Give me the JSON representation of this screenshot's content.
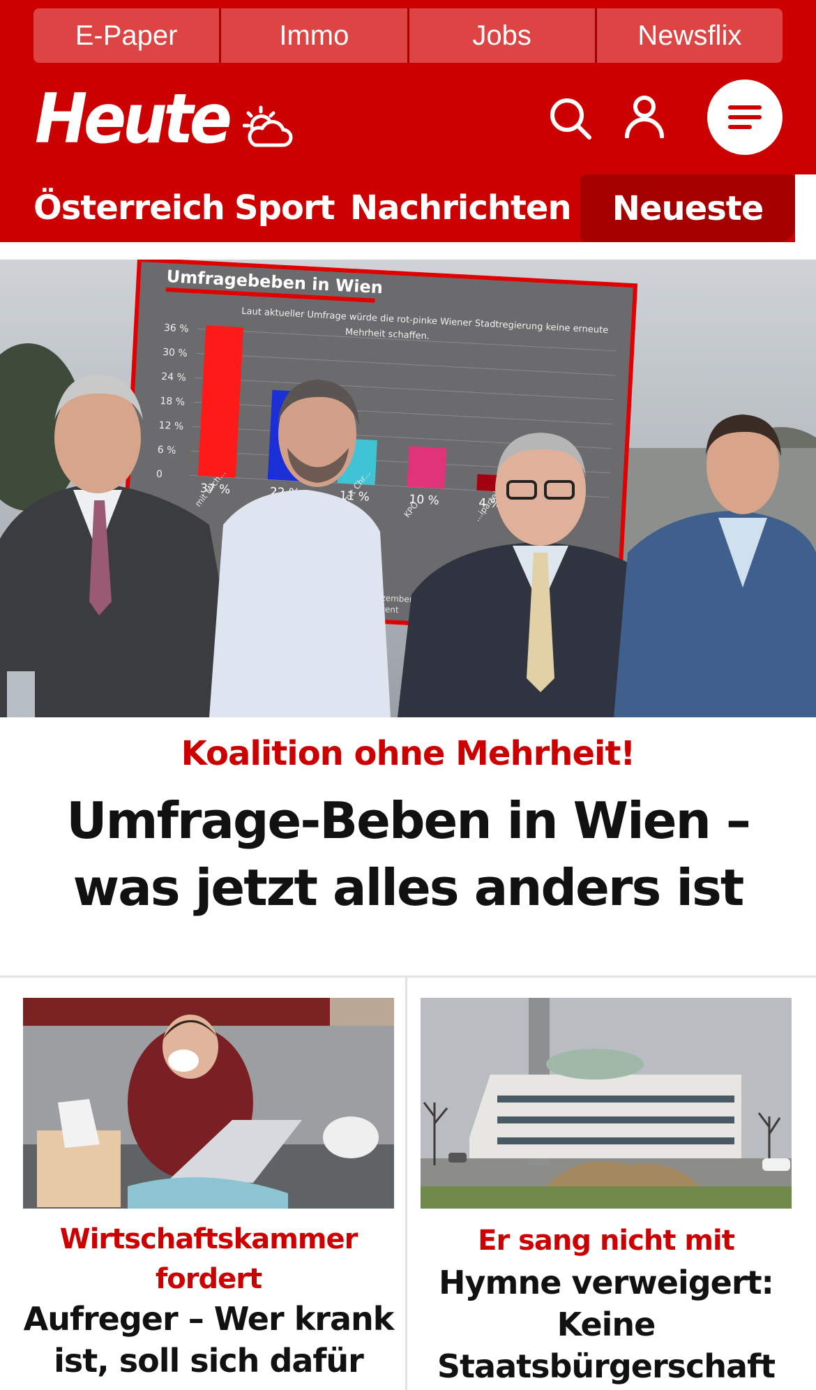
{
  "top_links": [
    "E-Paper",
    "Immo",
    "Jobs",
    "Newsflix"
  ],
  "brand": {
    "logo_text": "Heute",
    "accent": "#cc0000",
    "dark_accent": "#a50000"
  },
  "nav": {
    "items": [
      "Österreich",
      "Sport",
      "Nachrichten"
    ],
    "highlight": "Neueste"
  },
  "hero": {
    "kicker": "Koalition ohne Mehrheit!",
    "title": "Umfrage-Beben in Wien – was jetzt alles anders ist",
    "graphic": {
      "heading": "Umfragebeben in Wien",
      "subtitle_line1": "Laut aktueller Umfrage würde die rot-pinke Wiener Stadtregierung keine erneute",
      "subtitle_line2": "Mehrheit schaffen.",
      "y_ticks": [
        "36 %",
        "30 %",
        "24 %",
        "18 %",
        "12 %",
        "6 %",
        "0"
      ],
      "bar_labels": [
        "37 %",
        "22 %",
        "11 %",
        "10 %",
        "4 %"
      ],
      "bar_values": [
        37,
        22,
        11,
        10,
        4
      ],
      "bar_colors": [
        "#ff1a1a",
        "#1a2fd6",
        "#3fc4d6",
        "#e0337a",
        "#a30010"
      ],
      "category_labels": [
        "mit Mich...",
        "...er",
        "OS mit Chr...",
        "KPÖ",
        "...ipartei mi..."
      ],
      "footnote_line1": "...zember 2024",
      "footnote_line2": "...zent"
    }
  },
  "cards": [
    {
      "kicker": "Wirtschaftskammer fordert",
      "title": "Aufreger – Wer krank ist, soll sich dafür"
    },
    {
      "kicker": "Er sang nicht mit",
      "title": "Hymne verweigert: Keine Staatsbürgerschaft f..."
    }
  ]
}
